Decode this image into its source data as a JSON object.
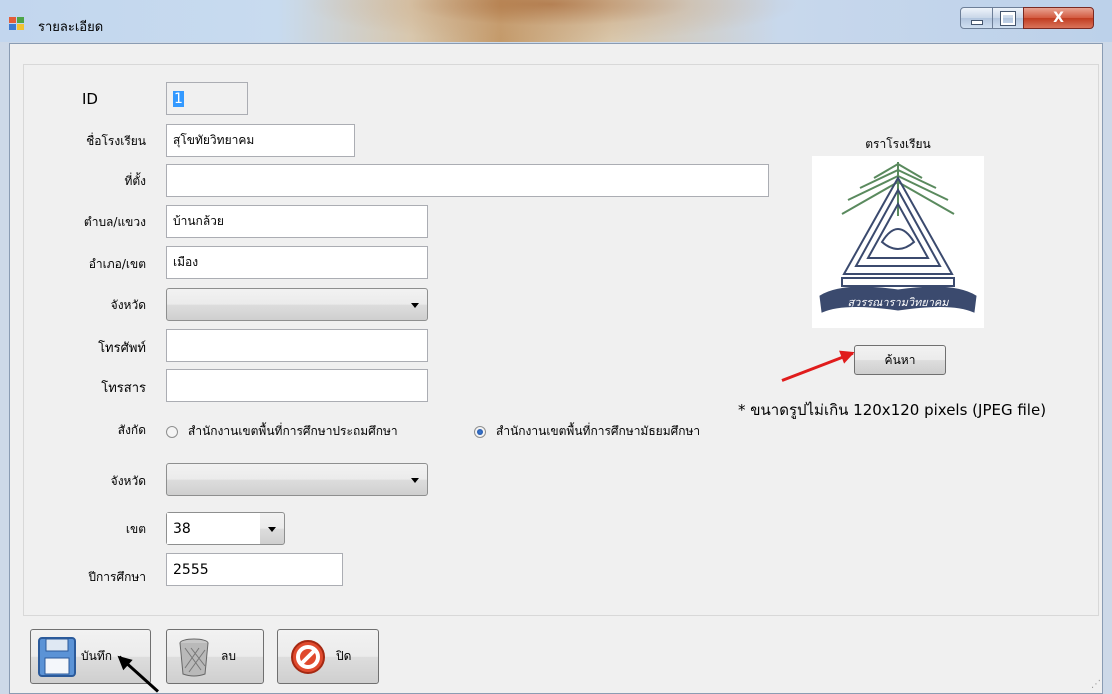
{
  "window": {
    "title": "รายละเอียด",
    "close_glyph": "X"
  },
  "form": {
    "id": {
      "label": "ID",
      "value": "1"
    },
    "school_name": {
      "label": "ชื่อโรงเรียน",
      "value": "สุโขทัยวิทยาคม"
    },
    "location": {
      "label": "ที่ตั้ง",
      "value": ""
    },
    "subdistrict": {
      "label": "ตำบล/แขวง",
      "value": "บ้านกล้วย"
    },
    "district": {
      "label": "อำเภอ/เขต",
      "value": "เมือง"
    },
    "province": {
      "label": "จังหวัด",
      "value": ""
    },
    "phone": {
      "label": "โทรศัพท์",
      "value": ""
    },
    "fax": {
      "label": "โทรสาร",
      "value": ""
    },
    "affiliation": {
      "label": "สังกัด",
      "options": [
        {
          "label": "สำนักงานเขตพื้นที่การศึกษาประถมศึกษา",
          "selected": false
        },
        {
          "label": "สำนักงานเขตพื้นที่การศึกษามัธยมศึกษา",
          "selected": true
        }
      ]
    },
    "area_province": {
      "label": "จังหวัด",
      "value": ""
    },
    "area": {
      "label": "เขต",
      "value": "38"
    },
    "academic_year": {
      "label": "ปีการศึกษา",
      "value": "2555"
    }
  },
  "logo": {
    "title": "ตราโรงเรียน",
    "banner_text": "สุวรรณารามวิทยาคม",
    "browse_label": "ค้นหา",
    "note": "* ขนาดรูปไม่เกิน 120x120 pixels (JPEG file)"
  },
  "buttons": {
    "save_label": "บันทึก",
    "delete_label": "ลบ",
    "close_label": "ปิด"
  },
  "colors": {
    "annotation_arrow": "#e01c1c",
    "selection": "#3399ff"
  }
}
